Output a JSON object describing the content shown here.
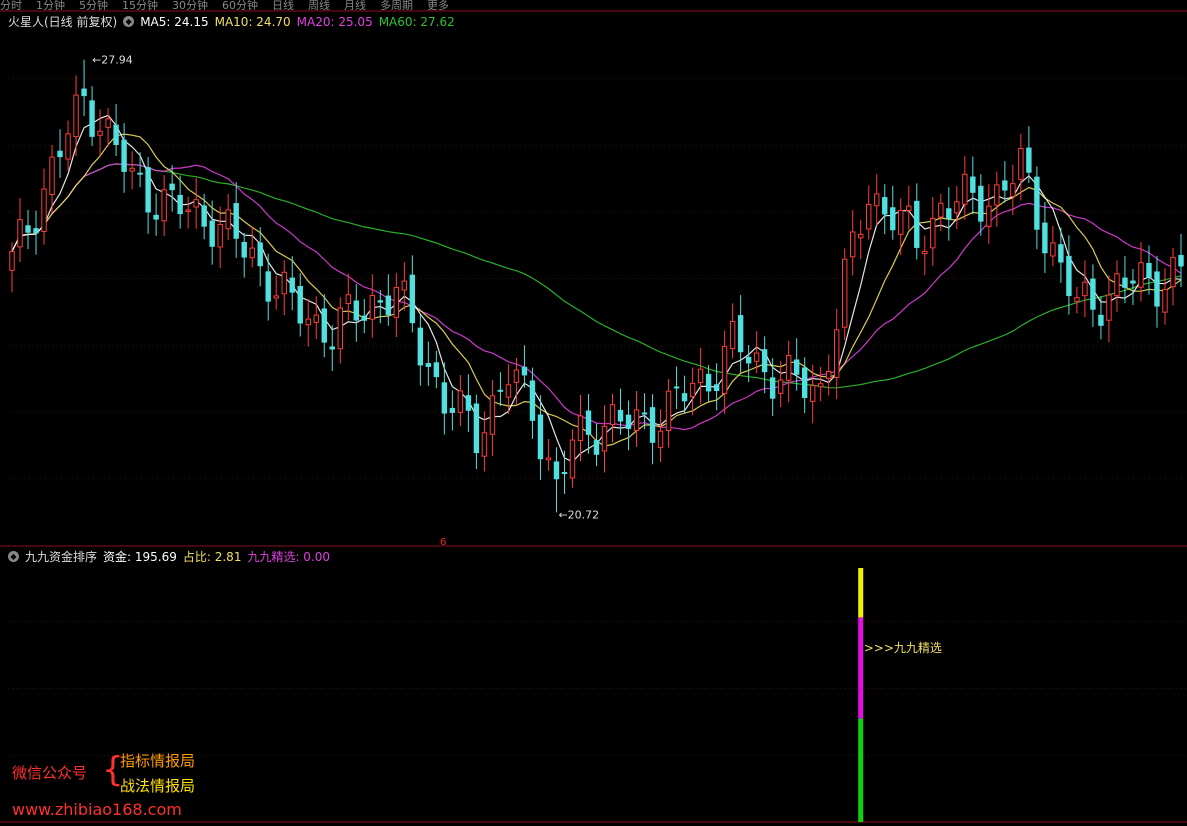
{
  "tabs": [
    "分时",
    "1分钟",
    "5分钟",
    "15分钟",
    "30分钟",
    "60分钟",
    "日线",
    "周线",
    "月线",
    "多周期",
    "更多"
  ],
  "main_legend": {
    "title": "火星人(日线 前复权)",
    "ma": [
      {
        "label": "MA5: 24.15",
        "color": "#ffffff"
      },
      {
        "label": "MA10: 24.70",
        "color": "#f0e060"
      },
      {
        "label": "MA20: 25.05",
        "color": "#e040e0"
      },
      {
        "label": "MA60: 27.62",
        "color": "#30c030"
      }
    ]
  },
  "indicator_legend": {
    "title": "九九资金排序",
    "items": [
      {
        "label": "资金: 195.69",
        "color": "#ffffff"
      },
      {
        "label": "占比: 2.81",
        "color": "#f0e060"
      },
      {
        "label": "九九精选: 0.00",
        "color": "#e040e0"
      }
    ]
  },
  "annotations": {
    "high": "27.94",
    "low": "20.72",
    "signal_text": ">>>九九精选",
    "marker": "6"
  },
  "watermark": {
    "label": "微信公众号",
    "line1": "指标情报局",
    "line2": "战法情报局",
    "url": "www.zhibiao168.com"
  },
  "colors": {
    "up": "#ff3b3b",
    "down": "#50e0e0",
    "ma5": "#ffffff",
    "ma10": "#f0e060",
    "ma20": "#e040e0",
    "ma60": "#30c030"
  },
  "chart_data": {
    "type": "candlestick",
    "ylim": [
      20.2,
      28.7
    ],
    "high": 27.94,
    "low": 20.72,
    "count": 147,
    "close_anchors": [
      [
        0,
        24.7
      ],
      [
        5,
        26.2
      ],
      [
        9,
        27.3
      ],
      [
        11,
        27.0
      ],
      [
        15,
        26.0
      ],
      [
        20,
        25.6
      ],
      [
        25,
        25.4
      ],
      [
        30,
        24.8
      ],
      [
        35,
        24.0
      ],
      [
        40,
        23.6
      ],
      [
        45,
        24.1
      ],
      [
        48,
        24.2
      ],
      [
        50,
        23.7
      ],
      [
        54,
        22.5
      ],
      [
        58,
        22.0
      ],
      [
        62,
        22.9
      ],
      [
        65,
        22.4
      ],
      [
        68,
        21.1
      ],
      [
        70,
        21.8
      ],
      [
        74,
        22.2
      ],
      [
        78,
        22.1
      ],
      [
        81,
        22.3
      ],
      [
        84,
        22.6
      ],
      [
        87,
        22.9
      ],
      [
        90,
        23.4
      ],
      [
        93,
        23.1
      ],
      [
        97,
        22.8
      ],
      [
        101,
        22.7
      ],
      [
        104,
        24.4
      ],
      [
        107,
        25.8
      ],
      [
        110,
        25.5
      ],
      [
        113,
        25.0
      ],
      [
        116,
        25.6
      ],
      [
        120,
        25.7
      ],
      [
        123,
        25.8
      ],
      [
        126,
        26.2
      ],
      [
        129,
        25.2
      ],
      [
        133,
        24.0
      ],
      [
        137,
        24.2
      ],
      [
        140,
        24.4
      ],
      [
        146,
        24.5
      ]
    ],
    "indicator": {
      "type": "bar",
      "index": 106,
      "segments": [
        {
          "color": "#f0f000",
          "value": 0.22
        },
        {
          "color": "#e010e0",
          "value": 0.45
        },
        {
          "color": "#10d010",
          "value": 0.46
        }
      ]
    }
  }
}
